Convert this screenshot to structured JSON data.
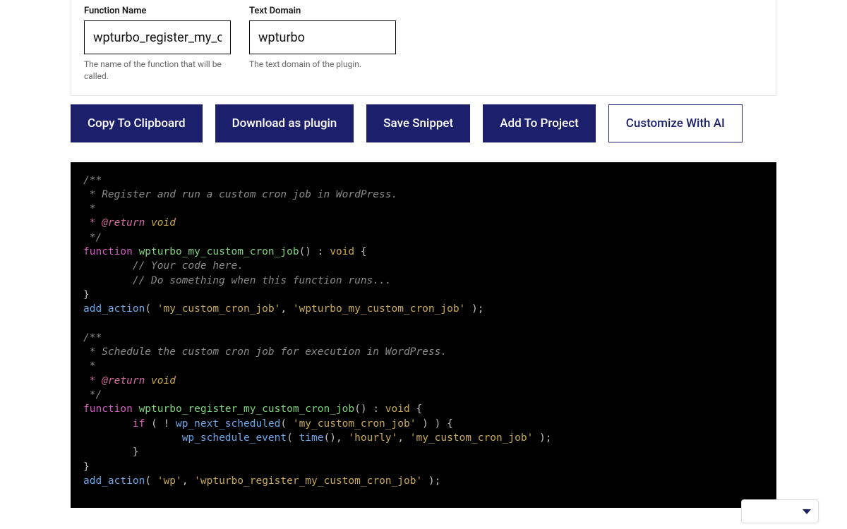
{
  "form": {
    "function_name": {
      "label": "Function Name",
      "value": "wpturbo_register_my_c",
      "help": "The name of the function that will be called."
    },
    "text_domain": {
      "label": "Text Domain",
      "value": "wpturbo",
      "help": "The text domain of the plugin."
    }
  },
  "buttons": {
    "copy": "Copy To Clipboard",
    "download": "Download as plugin",
    "save": "Save Snippet",
    "add": "Add To Project",
    "customize": "Customize With AI"
  },
  "code": {
    "block1": {
      "doc1": "/**",
      "doc2": " * Register and run a custom cron job in WordPress.",
      "doc3": " *",
      "doc4_tag": " * @return",
      "doc4_type": " void",
      "doc5": " */",
      "fn_kw": "function",
      "fn_name": "wpturbo_my_custom_cron_job",
      "fn_sig_open": "() : ",
      "fn_ret": "void",
      "brace_open": " {",
      "body1": "        // Your code here.",
      "body2": "        // Do something when this function runs...",
      "brace_close": "}",
      "action_fn": "add_action",
      "action_open": "( ",
      "action_arg1": "'my_custom_cron_job'",
      "action_sep": ", ",
      "action_arg2": "'wpturbo_my_custom_cron_job'",
      "action_close": " );"
    },
    "block2": {
      "doc1": "/**",
      "doc2": " * Schedule the custom cron job for execution in WordPress.",
      "doc3": " *",
      "doc4_tag": " * @return",
      "doc4_type": " void",
      "doc5": " */",
      "fn_kw": "function",
      "fn_name": "wpturbo_register_my_custom_cron_job",
      "fn_sig_open": "() : ",
      "fn_ret": "void",
      "brace_open": " {",
      "if_kw": "if",
      "if_open": " ( ! ",
      "wp_next": "wp_next_scheduled",
      "wp_next_open": "( ",
      "wp_next_arg": "'my_custom_cron_job'",
      "wp_next_close": " ) ) {",
      "sched_fn": "wp_schedule_event",
      "sched_open": "( ",
      "time_fn": "time",
      "time_call": "()",
      "sched_sep1": ", ",
      "sched_arg2": "'hourly'",
      "sched_sep2": ", ",
      "sched_arg3": "'my_custom_cron_job'",
      "sched_close": " );",
      "if_close": "        }",
      "brace_close": "}",
      "action_fn": "add_action",
      "action_open": "( ",
      "action_arg1": "'wp'",
      "action_sep": ", ",
      "action_arg2": "'wpturbo_register_my_custom_cron_job'",
      "action_close": " );"
    }
  }
}
